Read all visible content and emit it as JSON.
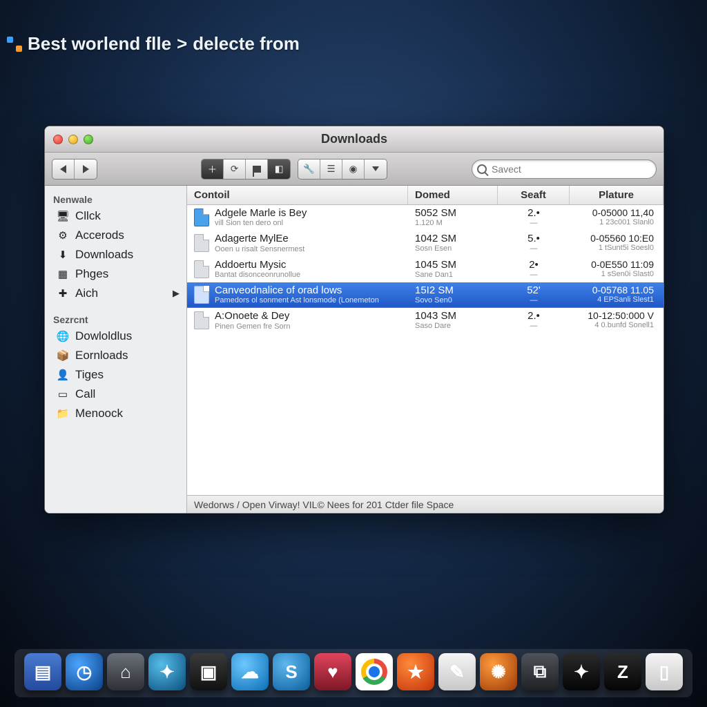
{
  "breadcrumb": {
    "part1": "Best worlend flle",
    "sep": ">",
    "part2": "delecte from"
  },
  "window": {
    "title": "Downloads",
    "search_placeholder": "Savect",
    "status": "Wedorws / Open Virway! VIL© Nees for 201 Ctder file Space"
  },
  "columns": {
    "name": "Contoil",
    "size": "Domed",
    "kind": "Seaft",
    "date": "Plature"
  },
  "sidebar": {
    "section1": {
      "header": "Nenwale",
      "items": [
        {
          "icon": "🖥",
          "label": "Cllck"
        },
        {
          "icon": "⚙",
          "label": "Accerods"
        },
        {
          "icon": "⬇",
          "label": "Downloads"
        },
        {
          "icon": "▦",
          "label": "Phges"
        },
        {
          "icon": "✚",
          "label": "Aich",
          "expand": "▶"
        }
      ]
    },
    "section2": {
      "header": "Sezrcnt",
      "items": [
        {
          "icon": "🌐",
          "label": "Dowloldlus"
        },
        {
          "icon": "📦",
          "label": "Eornloads"
        },
        {
          "icon": "👤",
          "label": "Tiges"
        },
        {
          "icon": "▭",
          "label": "Call"
        },
        {
          "icon": "📁",
          "label": "Menoock"
        }
      ]
    }
  },
  "files": [
    {
      "name": "Adgele Marle is Bey",
      "sub": "vill Sion ten dero onl",
      "size": "5052 SM",
      "size2": "1.120 M",
      "kind": "2.•",
      "kind2": "—",
      "date": "0-05000 11,40",
      "date2": "1  23c001 Slanl0",
      "blue": true,
      "selected": false
    },
    {
      "name": "Adagerte MylEe",
      "sub": "Ooen u risalt  Sensnermest",
      "size": "1042 SM",
      "size2": "Sosn Esen",
      "kind": "5.•",
      "kind2": "—",
      "date": "0-05560 10:E0",
      "date2": "1  tSunt5i Soesl0",
      "blue": false,
      "selected": false
    },
    {
      "name": "Addoertu Mysic",
      "sub": "Bantat disonceonrunollue",
      "size": "1045 SM",
      "size2": "Sane Dan1",
      "kind": "2•",
      "kind2": "—",
      "date": "0-0E550 11:09",
      "date2": "1  sSen0i Slast0",
      "blue": false,
      "selected": false
    },
    {
      "name": "Canveodnalice of orad lows",
      "sub": "Pamedors ol sonment Ast lonsmode (Lonemeton",
      "size": "15I2 SM",
      "size2": "Sovo Sen0",
      "kind": "52'",
      "kind2": "—",
      "date": "0-05768 11.05",
      "date2": "4  EPSanli Slest1",
      "blue": false,
      "selected": true
    },
    {
      "name": "A:Onoete & Dey",
      "sub": "Pinen Gemen fre Sorn",
      "size": "1043 SM",
      "size2": "Saso Dare",
      "kind": "2.•",
      "kind2": "—",
      "date": "10-12:50:000 V",
      "date2": "4  0.bunfd Sonell1",
      "blue": false,
      "selected": false
    }
  ],
  "dock": [
    {
      "name": "finder-icon",
      "glyph": "▤"
    },
    {
      "name": "dashboard-icon",
      "glyph": "◷"
    },
    {
      "name": "home-icon",
      "glyph": "⌂"
    },
    {
      "name": "safari-icon",
      "glyph": "✦"
    },
    {
      "name": "media-icon",
      "glyph": "▣"
    },
    {
      "name": "cloud-icon",
      "glyph": "☁"
    },
    {
      "name": "skype-icon",
      "glyph": "S"
    },
    {
      "name": "health-icon",
      "glyph": "♥"
    },
    {
      "name": "chrome-icon",
      "glyph": ""
    },
    {
      "name": "favorites-icon",
      "glyph": "★"
    },
    {
      "name": "notes-icon",
      "glyph": "✎"
    },
    {
      "name": "firefox-icon",
      "glyph": "✺"
    },
    {
      "name": "box-icon",
      "glyph": "⧉"
    },
    {
      "name": "terminal-icon",
      "glyph": "✦"
    },
    {
      "name": "z-app-icon",
      "glyph": "Z"
    },
    {
      "name": "documents-icon",
      "glyph": "▯"
    }
  ]
}
